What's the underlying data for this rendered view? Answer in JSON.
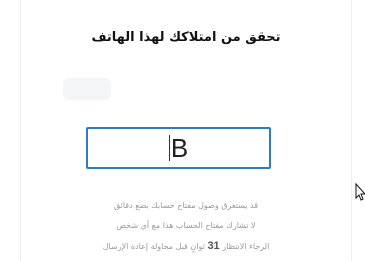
{
  "dialog": {
    "title": "تحقق من امتلاكك لهذا الهاتف",
    "code_value": "B",
    "info_line_1": "قد يستغرق وصول مفتاح حسابك بضع دقائق",
    "info_line_2": "لا تشارك مفتاح الحساب هذا مع أي شخص",
    "info_line_3_before": "الرجاء الانتظار",
    "countdown": "31",
    "info_line_3_after": "ثوانٍ قبل محاولة إعادة الإرسال"
  },
  "colors": {
    "accent_border": "#2f7bc5",
    "muted_text": "#9a9a9a"
  },
  "icons": {
    "pointer": "arrow-cursor-icon"
  }
}
